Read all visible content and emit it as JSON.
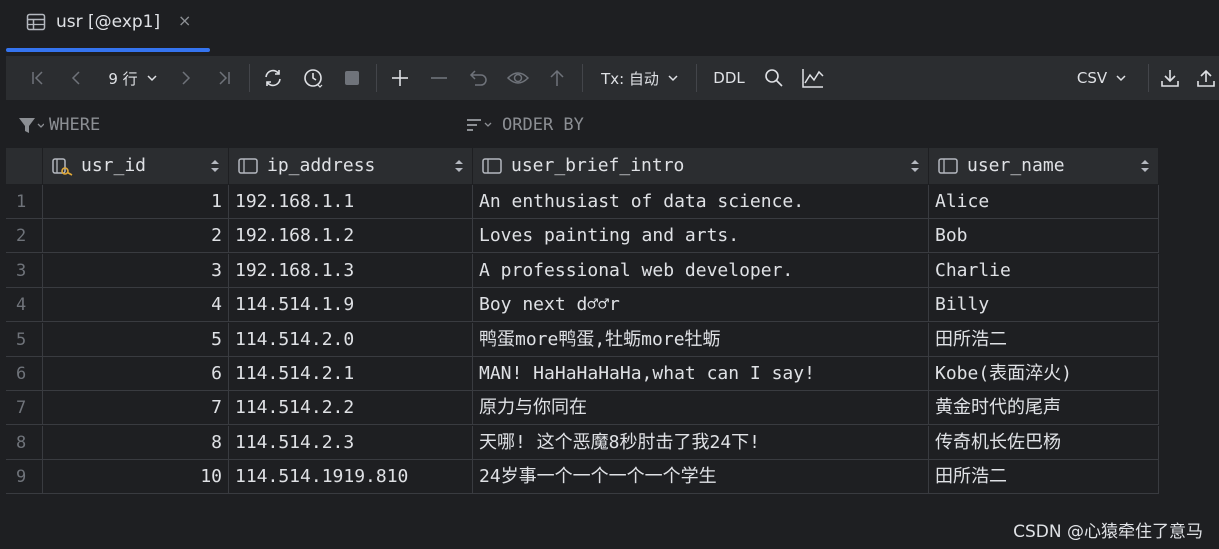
{
  "tab": {
    "title": "usr [@exp1]",
    "close": "×"
  },
  "toolbar": {
    "row_count": "9 行",
    "tx_mode": "Tx: 自动",
    "ddl": "DDL",
    "export_format": "CSV"
  },
  "filter": {
    "where": "WHERE",
    "order_by": "ORDER BY"
  },
  "table": {
    "columns": [
      {
        "name": "usr_id",
        "icon": "primary-key-column-icon"
      },
      {
        "name": "ip_address",
        "icon": "column-icon"
      },
      {
        "name": "user_brief_intro",
        "icon": "column-icon"
      },
      {
        "name": "user_name",
        "icon": "column-icon"
      }
    ],
    "rows": [
      {
        "rownum": "1",
        "usr_id": "1",
        "ip_address": "192.168.1.1",
        "user_brief_intro": "An enthusiast of data science.",
        "user_name": "Alice"
      },
      {
        "rownum": "2",
        "usr_id": "2",
        "ip_address": "192.168.1.2",
        "user_brief_intro": "Loves painting and arts.",
        "user_name": "Bob"
      },
      {
        "rownum": "3",
        "usr_id": "3",
        "ip_address": "192.168.1.3",
        "user_brief_intro": "A professional web developer.",
        "user_name": "Charlie"
      },
      {
        "rownum": "4",
        "usr_id": "4",
        "ip_address": "114.514.1.9",
        "user_brief_intro": "Boy next d♂♂r",
        "user_name": "Billy"
      },
      {
        "rownum": "5",
        "usr_id": "5",
        "ip_address": "114.514.2.0",
        "user_brief_intro": "鸭蛋more鸭蛋,牡蛎more牡蛎",
        "user_name": "田所浩二"
      },
      {
        "rownum": "6",
        "usr_id": "6",
        "ip_address": "114.514.2.1",
        "user_brief_intro": "MAN! HaHaHaHaHa,what can I say!",
        "user_name": "Kobe(表面淬火)"
      },
      {
        "rownum": "7",
        "usr_id": "7",
        "ip_address": "114.514.2.2",
        "user_brief_intro": "原力与你同在",
        "user_name": "黄金时代的尾声"
      },
      {
        "rownum": "8",
        "usr_id": "8",
        "ip_address": "114.514.2.3",
        "user_brief_intro": "天哪! 这个恶魔8秒肘击了我24下!",
        "user_name": "传奇机长佐巴杨"
      },
      {
        "rownum": "9",
        "usr_id": "10",
        "ip_address": "114.514.1919.810",
        "user_brief_intro": "24岁事一个一个一个一个学生",
        "user_name": "田所浩二"
      }
    ]
  },
  "watermark": "CSDN @心猿牵住了意马",
  "colors": {
    "accent": "#3574f0",
    "background": "#1e1f22",
    "panel": "#2b2d30",
    "key_icon": "#e0a838"
  }
}
